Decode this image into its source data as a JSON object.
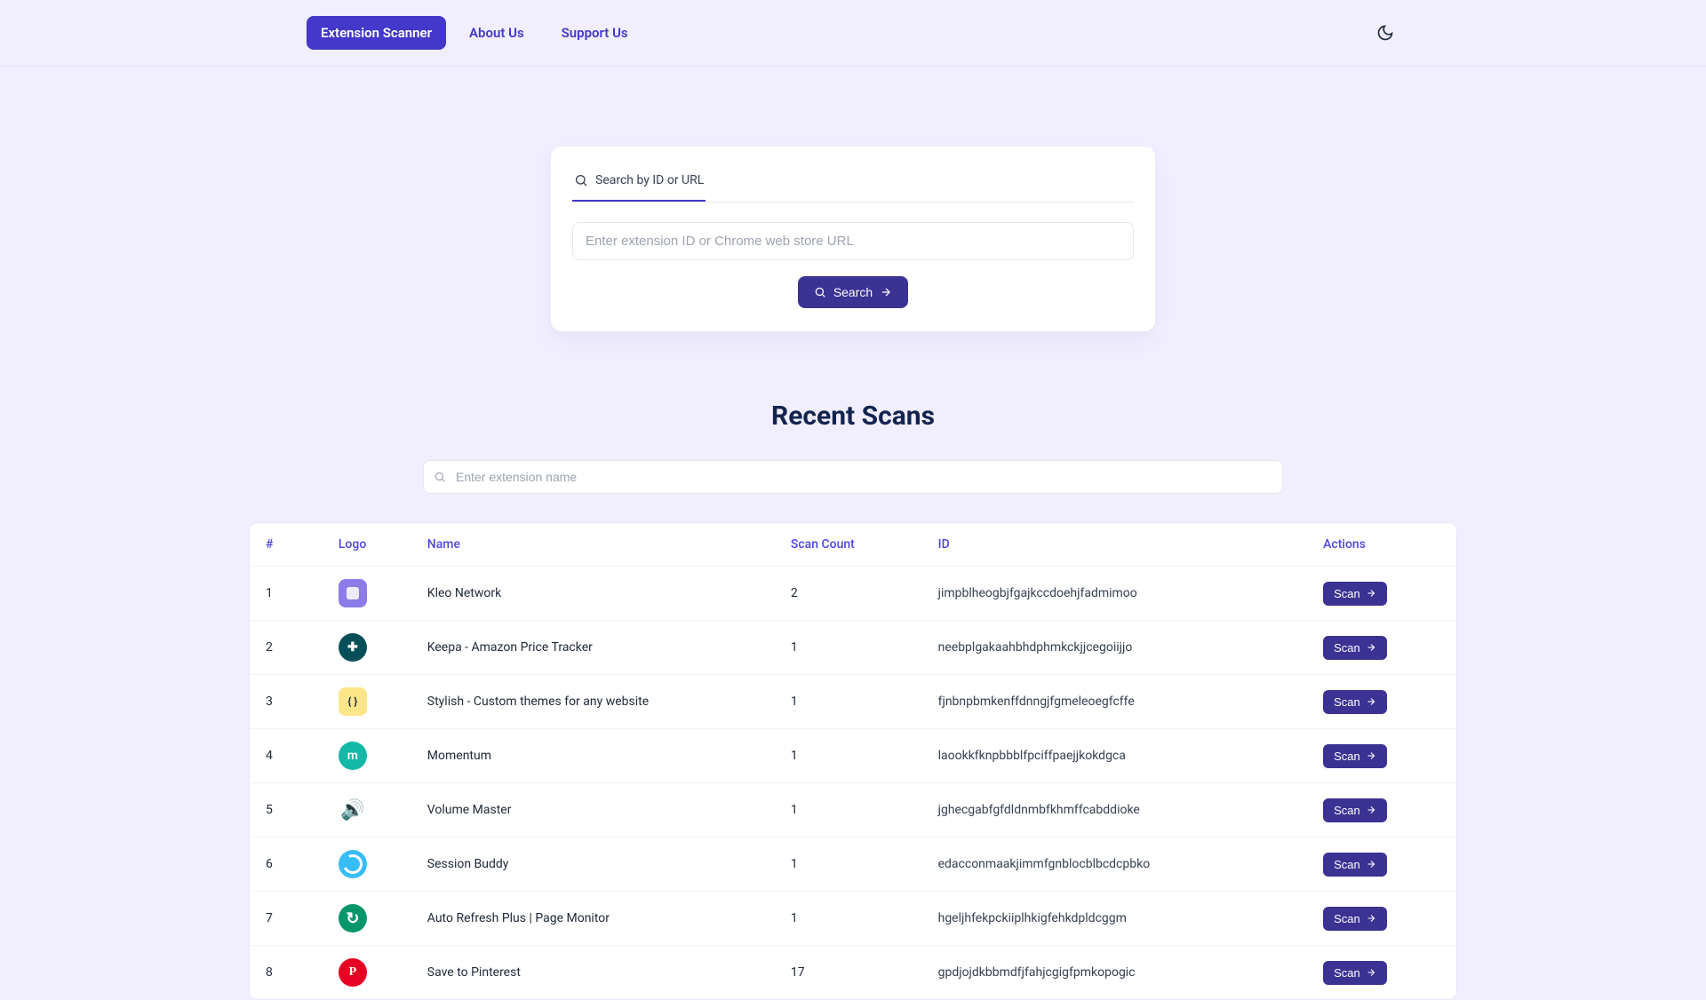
{
  "nav": {
    "items": [
      {
        "label": "Extension Scanner",
        "active": true
      },
      {
        "label": "About Us",
        "active": false
      },
      {
        "label": "Support Us",
        "active": false
      }
    ]
  },
  "search_card": {
    "tab_label": "Search by ID or URL",
    "input_placeholder": "Enter extension ID or Chrome web store URL",
    "button_label": "Search"
  },
  "recent_scans": {
    "title": "Recent Scans",
    "filter_placeholder": "Enter extension name",
    "columns": {
      "num": "#",
      "logo": "Logo",
      "name": "Name",
      "count": "Scan Count",
      "id": "ID",
      "actions": "Actions"
    },
    "action_label": "Scan",
    "rows": [
      {
        "num": "1",
        "logo_class": "logo-kleo",
        "name": "Kleo Network",
        "count": "2",
        "id": "jimpblheogbjfgajkccdoehjfadmimoo"
      },
      {
        "num": "2",
        "logo_class": "logo-keepa",
        "name": "Keepa - Amazon Price Tracker",
        "count": "1",
        "id": "neebplgakaahbhdphmkckjjcegoiijjo"
      },
      {
        "num": "3",
        "logo_class": "logo-stylish",
        "name": "Stylish - Custom themes for any website",
        "count": "1",
        "id": "fjnbnpbmkenffdnngjfgmeleoegfcffe"
      },
      {
        "num": "4",
        "logo_class": "logo-momentum",
        "name": "Momentum",
        "count": "1",
        "id": "laookkfknpbbblfpciffpaejjkokdgca"
      },
      {
        "num": "5",
        "logo_class": "logo-volume",
        "name": "Volume Master",
        "count": "1",
        "id": "jghecgabfgfdldnmbfkhmffcabddioke"
      },
      {
        "num": "6",
        "logo_class": "logo-session",
        "name": "Session Buddy",
        "count": "1",
        "id": "edacconmaakjimmfgnblocblbcdcpbko"
      },
      {
        "num": "7",
        "logo_class": "logo-refresh",
        "name": "Auto Refresh Plus | Page Monitor",
        "count": "1",
        "id": "hgeljhfekpckiiplhkigfehkdpldcggm"
      },
      {
        "num": "8",
        "logo_class": "logo-pinterest",
        "name": "Save to Pinterest",
        "count": "17",
        "id": "gpdjojdkbbmdfjfahjcgigfpmkopogic"
      }
    ]
  }
}
